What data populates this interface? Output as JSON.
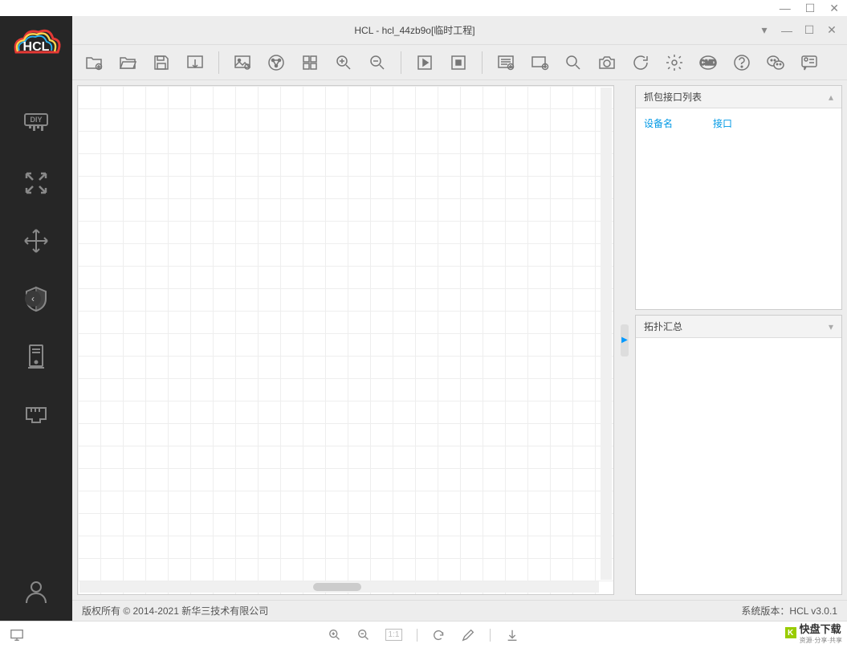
{
  "outer_window": {
    "minimize": "—",
    "maximize": "☐",
    "close": "✕"
  },
  "inner_window": {
    "title": "HCL - hcl_44zb9o[临时工程]",
    "dropdown": "▾",
    "minimize": "—",
    "maximize": "☐",
    "close": "✕"
  },
  "logo_text": "HCL",
  "right_panel": {
    "capture": {
      "title": "抓包接口列表",
      "col1": "设备名",
      "col2": "接口"
    },
    "topology": {
      "title": "拓扑汇总"
    }
  },
  "status": {
    "copyright": "版权所有 © 2014-2021 新华三技术有限公司",
    "version_label": "系统版本：",
    "version": "HCL v3.0.1"
  },
  "bottom_bar": {
    "ratio": "1:1"
  },
  "watermark": {
    "brand": "快盘下载",
    "sub": "资源·分享·共享"
  }
}
